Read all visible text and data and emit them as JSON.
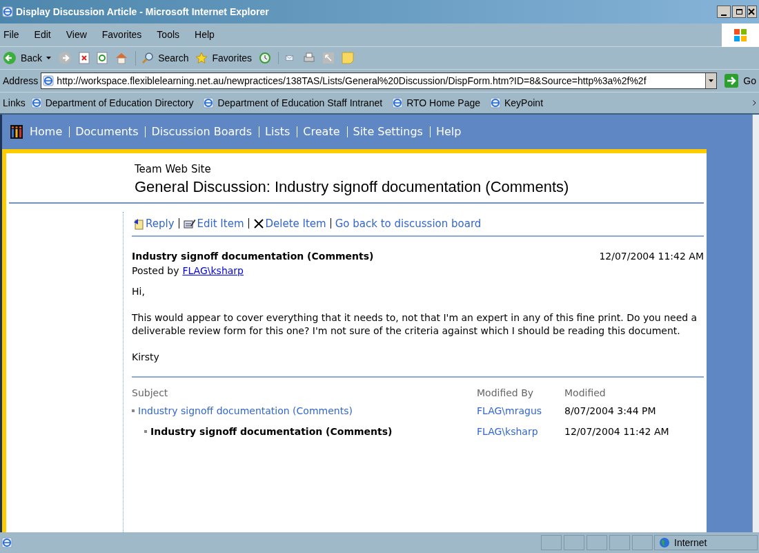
{
  "window": {
    "title": "Display Discussion Article - Microsoft Internet Explorer"
  },
  "menu": [
    "File",
    "Edit",
    "View",
    "Favorites",
    "Tools",
    "Help"
  ],
  "toolbar": {
    "back": "Back",
    "search": "Search",
    "favorites": "Favorites"
  },
  "address": {
    "label": "Address",
    "url": "http://workspace.flexiblelearning.net.au/newpractices/138TAS/Lists/General%20Discussion/DispForm.htm?ID=8&Source=http%3a%2f%2f",
    "go": "Go"
  },
  "links": {
    "label": "Links",
    "items": [
      "Department of Education Directory",
      "Department of Education Staff Intranet",
      "RTO Home Page",
      "KeyPoint"
    ]
  },
  "site_nav": [
    "Home",
    "Documents",
    "Discussion Boards",
    "Lists",
    "Create",
    "Site Settings",
    "Help"
  ],
  "site_title": "Team Web Site",
  "page_title": "General Discussion: Industry signoff documentation (Comments)",
  "actions": [
    {
      "kind": "reply",
      "label": "Reply"
    },
    {
      "kind": "edit",
      "label": "Edit Item"
    },
    {
      "kind": "delete",
      "label": "Delete Item"
    },
    {
      "kind": "back",
      "label": "Go back to discussion board"
    }
  ],
  "post": {
    "subject": "Industry signoff documentation (Comments)",
    "date": "12/07/2004 11:42 AM",
    "posted_by_label": "Posted by",
    "author": "FLAG\\ksharp",
    "body": [
      "Hi,",
      "This would appear to cover everything that it needs to, not that I'm an expert in any of this fine print. Do you need a deliverable review form for this one? I'm not sure of the criteria against which I should be reading this document.",
      "Kirsty"
    ]
  },
  "thread": {
    "columns": [
      "Subject",
      "Modified By",
      "Modified"
    ],
    "rows": [
      {
        "subject": "Industry signoff documentation (Comments)",
        "by": "FLAG\\mragus",
        "modified": "8/07/2004 3:44 PM",
        "selected": false,
        "children": [
          {
            "subject": "Industry signoff documentation (Comments)",
            "by": "FLAG\\ksharp",
            "modified": "12/07/2004 11:42 AM",
            "selected": true
          }
        ]
      }
    ]
  },
  "status_bar": {
    "zone": "Internet"
  }
}
